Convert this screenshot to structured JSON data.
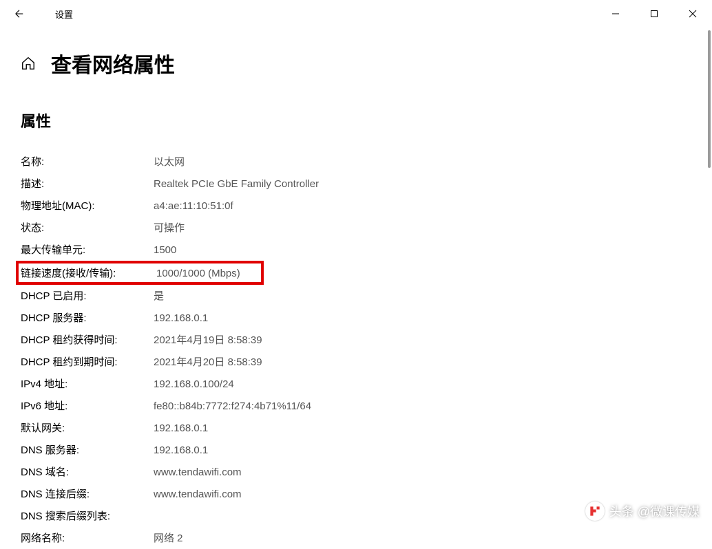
{
  "titlebar": {
    "title": "设置"
  },
  "page": {
    "title": "查看网络属性",
    "section_title": "属性"
  },
  "properties": [
    {
      "label": "名称:",
      "value": "以太网"
    },
    {
      "label": "描述:",
      "value": "Realtek PCIe GbE Family Controller"
    },
    {
      "label": "物理地址(MAC):",
      "value": "a4:ae:11:10:51:0f"
    },
    {
      "label": "状态:",
      "value": "可操作"
    },
    {
      "label": "最大传输单元:",
      "value": "1500"
    },
    {
      "label": "链接速度(接收/传输):",
      "value": "1000/1000 (Mbps)",
      "highlight": true
    },
    {
      "label": "DHCP 已启用:",
      "value": "是"
    },
    {
      "label": "DHCP 服务器:",
      "value": "192.168.0.1"
    },
    {
      "label": "DHCP 租约获得时间:",
      "value": "2021年4月19日 8:58:39"
    },
    {
      "label": "DHCP 租约到期时间:",
      "value": "2021年4月20日 8:58:39"
    },
    {
      "label": "IPv4 地址:",
      "value": "192.168.0.100/24"
    },
    {
      "label": "IPv6 地址:",
      "value": "fe80::b84b:7772:f274:4b71%11/64"
    },
    {
      "label": "默认网关:",
      "value": "192.168.0.1"
    },
    {
      "label": "DNS 服务器:",
      "value": "192.168.0.1"
    },
    {
      "label": "DNS 域名:",
      "value": "www.tendawifi.com"
    },
    {
      "label": "DNS 连接后缀:",
      "value": "www.tendawifi.com"
    },
    {
      "label": "DNS 搜索后缀列表:",
      "value": ""
    },
    {
      "label": "网络名称:",
      "value": "网络 2"
    }
  ],
  "watermark": {
    "text": "头条 @微课传媒"
  }
}
